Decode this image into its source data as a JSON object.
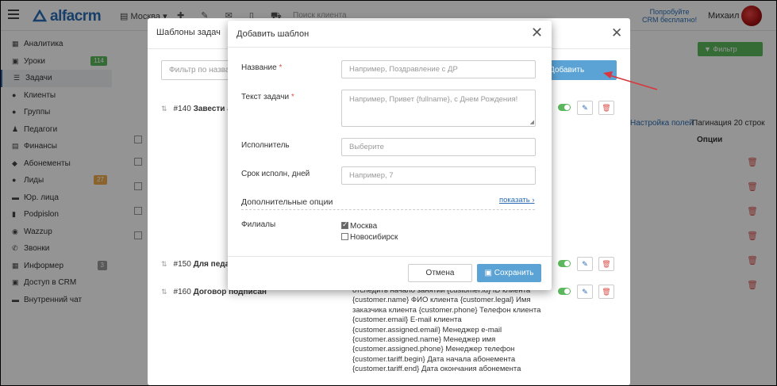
{
  "topbar": {
    "logo": "alfacrm",
    "branch": "Москва",
    "search_placeholder": "Поиск клиента",
    "promo_line1": "Попробуйте",
    "promo_line2": "CRM бесплатно!",
    "user_name": "Михаил"
  },
  "sidebar": {
    "items": [
      {
        "label": "Аналитика",
        "icon": "chart-icon"
      },
      {
        "label": "Уроки",
        "icon": "calendar-icon",
        "badge": "114",
        "badge_color": "#5cb85c"
      },
      {
        "label": "Задачи",
        "icon": "tasks-icon"
      },
      {
        "label": "Клиенты",
        "icon": "user-icon"
      },
      {
        "label": "Группы",
        "icon": "group-icon"
      },
      {
        "label": "Педагоги",
        "icon": "teacher-icon"
      },
      {
        "label": "Финансы",
        "icon": "money-icon"
      },
      {
        "label": "Абонементы",
        "icon": "tag-icon"
      },
      {
        "label": "Лиды",
        "icon": "lead-icon",
        "badge": "27",
        "badge_color": "#f0ad4e"
      },
      {
        "label": "Юр. лица",
        "icon": "building-icon"
      },
      {
        "label": "Podpislon",
        "icon": "pen-icon"
      },
      {
        "label": "Wazzup",
        "icon": "chat-icon"
      },
      {
        "label": "Звонки",
        "icon": "phone-icon"
      },
      {
        "label": "Информер",
        "icon": "informer-icon",
        "badge": "3",
        "badge_color": "#999999"
      },
      {
        "label": "Доступ в CRM",
        "icon": "lock-icon"
      },
      {
        "label": "Внутренний чат",
        "icon": "message-icon"
      }
    ]
  },
  "background": {
    "filter_button": "Фильтр",
    "settings_link": "Настройка полей",
    "pagination": "Пагинация 20 строк",
    "options_column": "Опции"
  },
  "templates_modal": {
    "title": "Шаблоны задач",
    "filter_placeholder": "Фильтр по названию",
    "add_button": "Добавить",
    "rows": [
      {
        "id": "#140",
        "name": "Завести абонемент"
      },
      {
        "id": "#150",
        "name": "Для педагога"
      },
      {
        "id": "#160",
        "name": "Договор подписан"
      }
    ],
    "variables": [
      "отследить начало занятий {customer.id} ID клиента",
      "{customer.name} ФИО клиента {customer.legal} Имя",
      "заказчика клиента {customer.phone} Телефон клиента",
      "{customer.email} E-mail клиента",
      "{customer.assigned.email} Менеджер e-mail",
      "{customer.assigned.name} Менеджер имя",
      "{customer.assigned.phone} Менеджер телефон",
      "{customer.tariff.begin} Дата начала абонемента",
      "{customer.tariff.end} Дата окончания абонемента"
    ]
  },
  "add_modal": {
    "title": "Добавить шаблон",
    "name_label": "Название",
    "name_placeholder": "Например, Поздравление с ДР",
    "text_label": "Текст задачи",
    "text_placeholder": "Например, Привет {fullname}, с Днем Рождения!",
    "assignee_label": "Исполнитель",
    "assignee_placeholder": "Выберите",
    "due_label": "Срок исполн, дней",
    "due_placeholder": "Например, 7",
    "extra_title": "Дополнительные опции",
    "show_link": "показать",
    "branches_label": "Филиалы",
    "branches": [
      {
        "label": "Москва",
        "checked": true
      },
      {
        "label": "Новосибирск",
        "checked": false
      }
    ],
    "cancel": "Отмена",
    "save": "Сохранить"
  }
}
